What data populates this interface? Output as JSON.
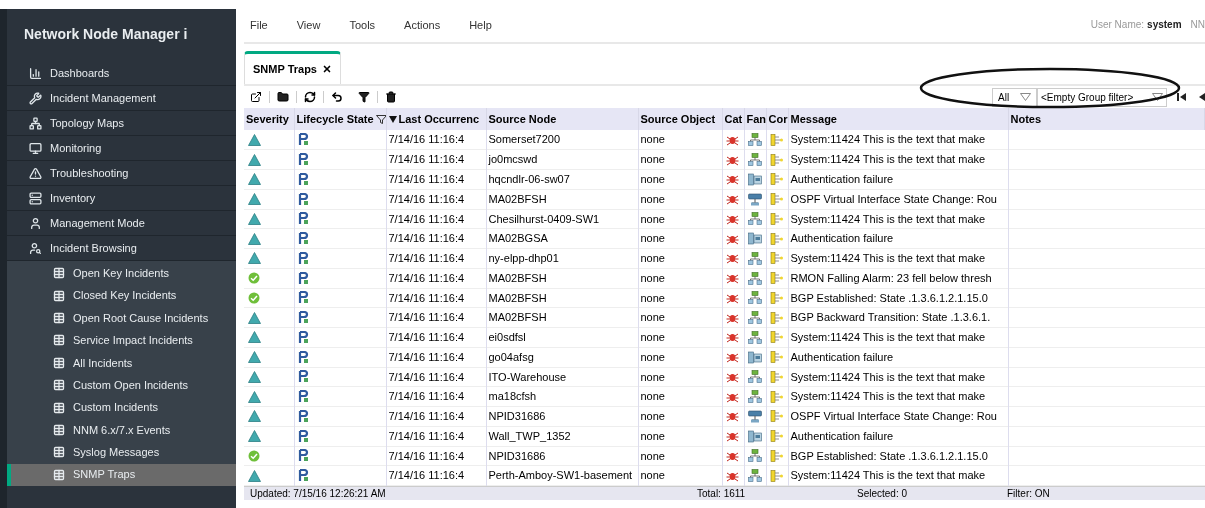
{
  "app_title": "Network Node Manager i",
  "sidebar": {
    "items": [
      {
        "label": "Dashboards",
        "kind": "chart",
        "selected": false
      },
      {
        "label": "Incident Management",
        "kind": "wrench",
        "selected": false
      },
      {
        "label": "Topology Maps",
        "kind": "topology",
        "selected": false
      },
      {
        "label": "Monitoring",
        "kind": "monitor",
        "selected": false
      },
      {
        "label": "Troubleshooting",
        "kind": "alert",
        "selected": false
      },
      {
        "label": "Inventory",
        "kind": "inventory",
        "selected": false
      },
      {
        "label": "Management Mode",
        "kind": "user",
        "selected": false
      },
      {
        "label": "Incident Browsing",
        "kind": "browse",
        "selected": false,
        "expanded": true,
        "children": [
          {
            "label": "Open Key Incidents",
            "selected": false
          },
          {
            "label": "Closed Key Incidents",
            "selected": false
          },
          {
            "label": "Open Root Cause Incidents",
            "selected": false
          },
          {
            "label": "Service Impact Incidents",
            "selected": false
          },
          {
            "label": "All Incidents",
            "selected": false
          },
          {
            "label": "Custom Open Incidents",
            "selected": false
          },
          {
            "label": "Custom Incidents",
            "selected": false
          },
          {
            "label": "NNM 6.x/7.x Events",
            "selected": false
          },
          {
            "label": "Syslog Messages",
            "selected": false
          },
          {
            "label": "SNMP Traps",
            "selected": true
          }
        ]
      }
    ]
  },
  "menu": [
    "File",
    "View",
    "Tools",
    "Actions",
    "Help"
  ],
  "user": {
    "label": "User Name:",
    "name": "system",
    "extra": "NN"
  },
  "tabs": [
    {
      "label": "SNMP Traps",
      "selected": true
    }
  ],
  "filters": {
    "scope": "All",
    "group": "<Empty Group filter>"
  },
  "table": {
    "columns": [
      "Severity",
      "Lifecycle State",
      "Last Occurrenc",
      "Source Node",
      "Source Object",
      "Cat",
      "Fan",
      "Cor",
      "Message",
      "Notes"
    ],
    "rows": [
      {
        "severity": {
          "kind": "warning"
        },
        "time": "7/14/16 11:16:4",
        "node": "Somerset7200",
        "object": "none",
        "device": {
          "kind": "switch"
        },
        "message": "System:11424 This is the text that make"
      },
      {
        "severity": {
          "kind": "warning"
        },
        "time": "7/14/16 11:16:4",
        "node": "jo0mcswd",
        "object": "none",
        "device": {
          "kind": "switch"
        },
        "message": "System:11424 This is the text that make"
      },
      {
        "severity": {
          "kind": "warning"
        },
        "time": "7/14/16 11:16:4",
        "node": "hqcndlr-06-sw07",
        "object": "none",
        "device": {
          "kind": "server"
        },
        "message": "Authentication failure"
      },
      {
        "severity": {
          "kind": "warning"
        },
        "time": "7/14/16 11:16:4",
        "node": "MA02BFSH",
        "object": "none",
        "device": {
          "kind": "router"
        },
        "message": "OSPF Virtual Interface State Change: Rou"
      },
      {
        "severity": {
          "kind": "warning"
        },
        "time": "7/14/16 11:16:4",
        "node": "Chesilhurst-0409-SW1",
        "object": "none",
        "device": {
          "kind": "switch"
        },
        "message": "System:11424 This is the text that make"
      },
      {
        "severity": {
          "kind": "warning"
        },
        "time": "7/14/16 11:16:4",
        "node": "MA02BGSA",
        "object": "none",
        "device": {
          "kind": "server"
        },
        "message": "Authentication failure"
      },
      {
        "severity": {
          "kind": "warning"
        },
        "time": "7/14/16 11:16:4",
        "node": "ny-elpp-dhp01",
        "object": "none",
        "device": {
          "kind": "switch"
        },
        "message": "System:11424 This is the text that make"
      },
      {
        "severity": {
          "kind": "normal"
        },
        "time": "7/14/16 11:16:4",
        "node": "MA02BFSH",
        "object": "none",
        "device": {
          "kind": "switch"
        },
        "message": "RMON Falling Alarm: 23 fell below thresh"
      },
      {
        "severity": {
          "kind": "normal"
        },
        "time": "7/14/16 11:16:4",
        "node": "MA02BFSH",
        "object": "none",
        "device": {
          "kind": "switch"
        },
        "message": "BGP Established: State .1.3.6.1.2.1.15.0"
      },
      {
        "severity": {
          "kind": "warning"
        },
        "time": "7/14/16 11:16:4",
        "node": "MA02BFSH",
        "object": "none",
        "device": {
          "kind": "switch"
        },
        "message": "BGP Backward Transition: State .1.3.6.1."
      },
      {
        "severity": {
          "kind": "warning"
        },
        "time": "7/14/16 11:16:4",
        "node": "ei0sdfsl",
        "object": "none",
        "device": {
          "kind": "switch"
        },
        "message": "System:11424 This is the text that make"
      },
      {
        "severity": {
          "kind": "warning"
        },
        "time": "7/14/16 11:16:4",
        "node": "go04afsg",
        "object": "none",
        "device": {
          "kind": "server"
        },
        "message": "Authentication failure"
      },
      {
        "severity": {
          "kind": "warning"
        },
        "time": "7/14/16 11:16:4",
        "node": "ITO-Warehouse",
        "object": "none",
        "device": {
          "kind": "switch"
        },
        "message": "System:11424 This is the text that make"
      },
      {
        "severity": {
          "kind": "warning"
        },
        "time": "7/14/16 11:16:4",
        "node": "ma18cfsh",
        "object": "none",
        "device": {
          "kind": "switch"
        },
        "message": "System:11424 This is the text that make"
      },
      {
        "severity": {
          "kind": "warning"
        },
        "time": "7/14/16 11:16:4",
        "node": "NPID31686",
        "object": "none",
        "device": {
          "kind": "router"
        },
        "message": "OSPF Virtual Interface State Change: Rou"
      },
      {
        "severity": {
          "kind": "warning"
        },
        "time": "7/14/16 11:16:4",
        "node": "Wall_TWP_1352",
        "object": "none",
        "device": {
          "kind": "server"
        },
        "message": "Authentication failure"
      },
      {
        "severity": {
          "kind": "normal"
        },
        "time": "7/14/16 11:16:4",
        "node": "NPID31686",
        "object": "none",
        "device": {
          "kind": "switch"
        },
        "message": "BGP Established: State .1.3.6.1.2.1.15.0"
      },
      {
        "severity": {
          "kind": "warning"
        },
        "time": "7/14/16 11:16:4",
        "node": "Perth-Amboy-SW1-basement",
        "object": "none",
        "device": {
          "kind": "switch"
        },
        "message": "System:11424 This is the text that make"
      }
    ]
  },
  "status_bar": {
    "updated": "Updated: 7/15/16 12:26:21 AM",
    "total": "Total: 1611",
    "selected": "Selected: 0",
    "filter": "Filter: ON"
  }
}
